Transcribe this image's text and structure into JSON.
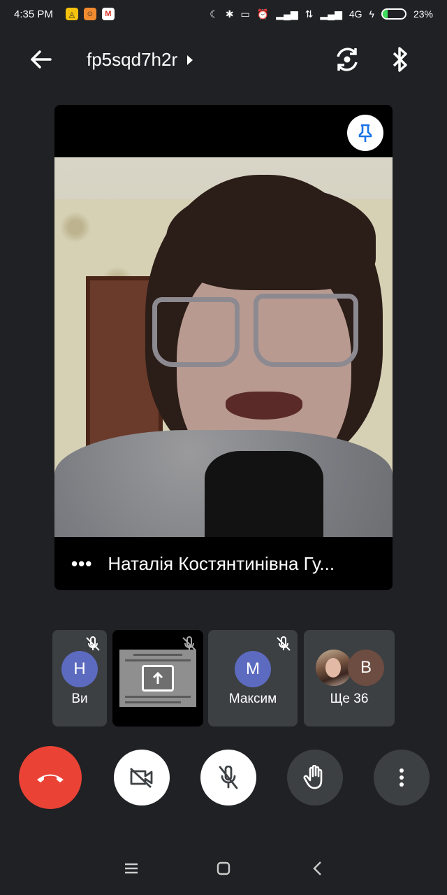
{
  "status_bar": {
    "time": "4:35 PM",
    "network": "4G",
    "battery_percent": "23%",
    "battery_level": 0.23,
    "notification_icons": [
      "vpn-icon",
      "avatar-app-icon",
      "gmail-icon"
    ]
  },
  "app_bar": {
    "meeting_code": "fp5sqd7h2r"
  },
  "main_tile": {
    "speaker_name": "Наталія Костянтинівна Гу...",
    "more_label": "•••"
  },
  "participants": [
    {
      "label": "Ви",
      "initial": "Н",
      "avatar_color": "#5c6bc0",
      "muted": true
    },
    {
      "label": "",
      "type": "presentation",
      "muted": true
    },
    {
      "label": "Максим",
      "initial": "М",
      "avatar_color": "#5c6bc0",
      "muted": true
    },
    {
      "label": "Ще 36",
      "initial": "В",
      "avatar_color": "#6d4c41"
    }
  ],
  "colors": {
    "background": "#202124",
    "tile": "#3c4043",
    "hangup": "#ea4335",
    "pin": "#1a73e8"
  }
}
